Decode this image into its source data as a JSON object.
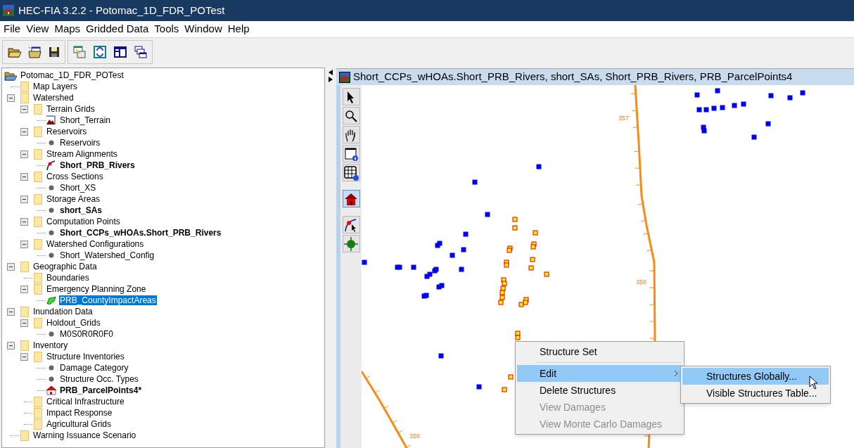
{
  "window": {
    "title": "HEC-FIA 3.2.2 - Potomac_1D_FDR_POTest"
  },
  "menu_bar": [
    "File",
    "View",
    "Maps",
    "Gridded Data",
    "Tools",
    "Window",
    "Help"
  ],
  "tree": {
    "label": "Potomac_1D_FDR_POTest",
    "kind": "project",
    "selected": false,
    "children": [
      {
        "label": "Map Layers",
        "kind": "folder",
        "selected": false
      },
      {
        "label": "Watershed",
        "kind": "folder",
        "expanded": true,
        "selected": false,
        "children": [
          {
            "label": "Terrain Grids",
            "kind": "folder",
            "expanded": true,
            "selected": false,
            "children": [
              {
                "label": "Short_Terrain",
                "kind": "terrain",
                "bold": false,
                "selected": false
              }
            ]
          },
          {
            "label": "Reservoirs",
            "kind": "folder",
            "expanded": true,
            "selected": false,
            "children": [
              {
                "label": "Reservoirs",
                "kind": "dot",
                "bold": false,
                "selected": false
              }
            ]
          },
          {
            "label": "Stream Alignments",
            "kind": "folder",
            "expanded": true,
            "selected": false,
            "children": [
              {
                "label": "Short_PRB_Rivers",
                "kind": "stream",
                "bold": true,
                "selected": false
              }
            ]
          },
          {
            "label": "Cross Sections",
            "kind": "folder",
            "expanded": true,
            "selected": false,
            "children": [
              {
                "label": "Short_XS",
                "kind": "dot",
                "bold": false,
                "selected": false
              }
            ]
          },
          {
            "label": "Storage Areas",
            "kind": "folder",
            "expanded": true,
            "selected": false,
            "children": [
              {
                "label": "short_SAs",
                "kind": "dot",
                "bold": true,
                "selected": false
              }
            ]
          },
          {
            "label": "Computation Points",
            "kind": "folder",
            "expanded": true,
            "selected": false,
            "children": [
              {
                "label": "Short_CCPs_wHOAs.Short_PRB_Rivers",
                "kind": "dot",
                "bold": true,
                "selected": false
              }
            ]
          },
          {
            "label": "Watershed Configurations",
            "kind": "folder",
            "expanded": true,
            "selected": false,
            "children": [
              {
                "label": "Short_Watershed_Config",
                "kind": "dot",
                "bold": false,
                "selected": false
              }
            ]
          }
        ]
      },
      {
        "label": "Geographic Data",
        "kind": "folder",
        "expanded": true,
        "selected": false,
        "children": [
          {
            "label": "Boundaries",
            "kind": "folder",
            "selected": false
          },
          {
            "label": "Emergency Planning Zone",
            "kind": "folder",
            "expanded": true,
            "selected": false,
            "children": [
              {
                "label": "PRB_CountyImpactAreas",
                "kind": "polygon",
                "bold": false,
                "selected": true
              }
            ]
          }
        ]
      },
      {
        "label": "Inundation Data",
        "kind": "folder",
        "expanded": true,
        "selected": false,
        "children": [
          {
            "label": "Holdout_Grids",
            "kind": "folder",
            "expanded": true,
            "selected": false,
            "children": [
              {
                "label": "M0S0R0R0F0",
                "kind": "dot",
                "bold": false,
                "selected": false
              }
            ]
          }
        ]
      },
      {
        "label": "Inventory",
        "kind": "folder",
        "expanded": true,
        "selected": false,
        "children": [
          {
            "label": "Structure Inventories",
            "kind": "folder",
            "expanded": true,
            "selected": false,
            "children": [
              {
                "label": "Damage Category",
                "kind": "dot",
                "bold": false,
                "selected": false
              },
              {
                "label": "Structure Occ. Types",
                "kind": "dot",
                "bold": false,
                "selected": false
              },
              {
                "label": "PRB_ParcelPoints4*",
                "kind": "structure",
                "bold": true,
                "selected": false
              }
            ]
          },
          {
            "label": "Critical Infrastructure",
            "kind": "folder",
            "selected": false
          },
          {
            "label": "Impact Response",
            "kind": "folder",
            "selected": false
          },
          {
            "label": "Agricultural Grids",
            "kind": "folder",
            "selected": false
          }
        ]
      },
      {
        "label": "Warning Issuance Scenario",
        "kind": "folder",
        "selected": false
      }
    ]
  },
  "map_window": {
    "title": "Short_CCPs_wHOAs.Short_PRB_Rivers, short_SAs, Short_PRB_Rivers, PRB_ParcelPoints4",
    "tools": [
      {
        "kind": "select",
        "selected": false
      },
      {
        "kind": "zoom",
        "selected": false
      },
      {
        "kind": "pan",
        "selected": false
      },
      {
        "kind": "window-info",
        "selected": false
      },
      {
        "kind": "table-info",
        "selected": false
      },
      {
        "kind": "structure",
        "selected": true
      },
      {
        "kind": "stream",
        "selected": false
      },
      {
        "kind": "point",
        "selected": false
      }
    ],
    "river_labels": [
      "357",
      "358",
      "358"
    ]
  },
  "context_menu": {
    "items": [
      {
        "kind": "item",
        "label": "Structure Set",
        "disabled": false,
        "selected": false
      },
      {
        "kind": "separator"
      },
      {
        "kind": "submenu",
        "label": "Edit",
        "disabled": false,
        "selected": true
      },
      {
        "kind": "item",
        "label": "Delete Structures",
        "disabled": false,
        "selected": false
      },
      {
        "kind": "item",
        "label": "View Damages",
        "disabled": true,
        "selected": false
      },
      {
        "kind": "item",
        "label": "View Monte Carlo Damages",
        "disabled": true,
        "selected": false
      }
    ],
    "submenu": [
      {
        "label": "Structures Globally...",
        "selected": true
      },
      {
        "label": "Visible Structures Table...",
        "selected": false
      }
    ]
  }
}
